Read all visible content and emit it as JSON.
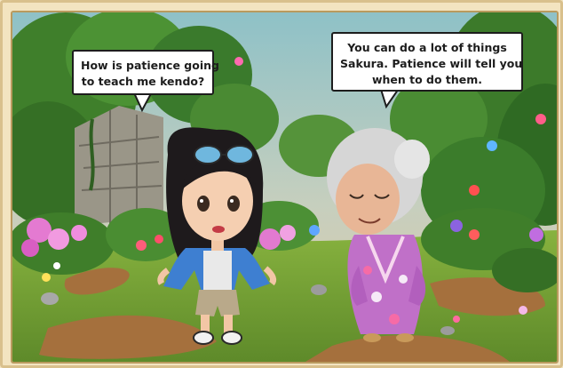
{
  "dialogue": {
    "sakura_line": [
      "How is patience going",
      "to teach me kendo?"
    ],
    "grandmother_line": [
      "You can do a lot of things",
      "Sakura. Patience will tell you",
      "when to do them."
    ]
  },
  "colors": {
    "sky": "#8ec1c7",
    "grass": "#6f9b32",
    "path": "#a5703d",
    "kimono": "#c070c8",
    "jacket": "#3e7fd1",
    "frame": "#f3e4c0"
  }
}
